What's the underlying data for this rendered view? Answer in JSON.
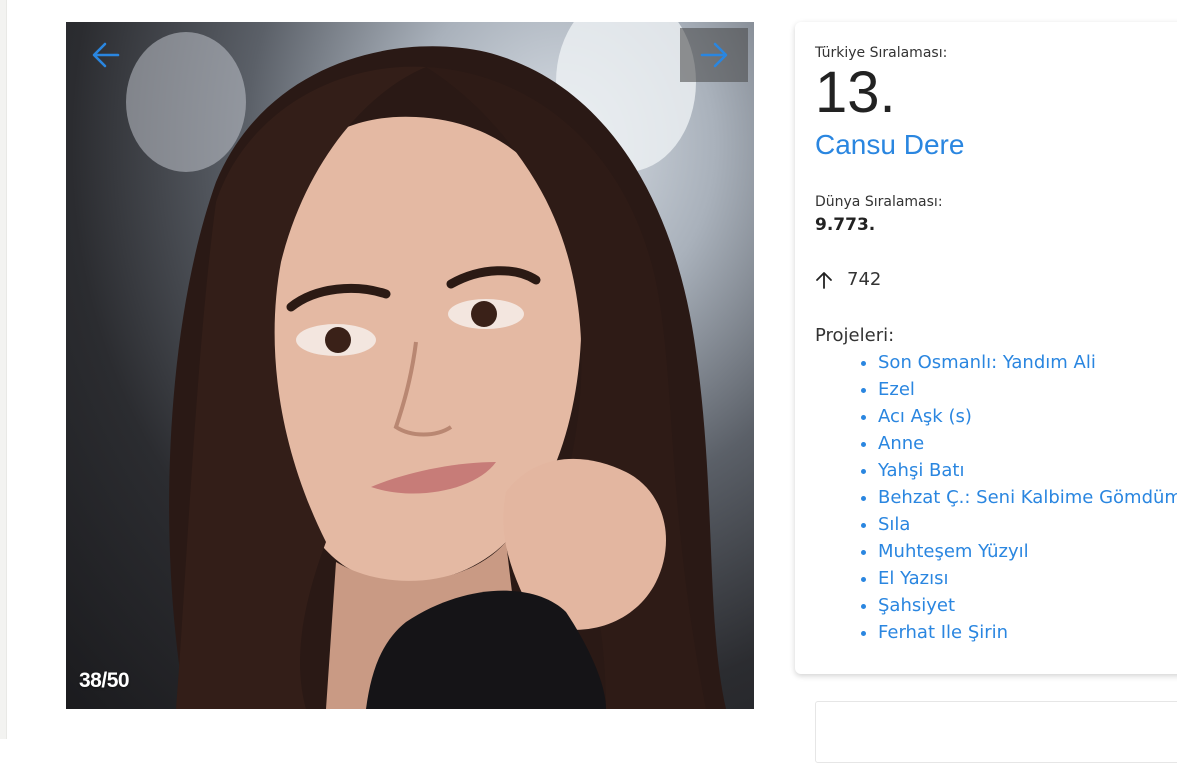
{
  "slider": {
    "counter": "38/50",
    "prev_icon": "arrow-left-icon",
    "next_icon": "arrow-right-icon",
    "accent": "#2a86e0"
  },
  "profile": {
    "turkey_rank_label": "Türkiye Sıralaması:",
    "turkey_rank": "13.",
    "name": "Cansu Dere",
    "world_rank_label": "Dünya Sıralaması:",
    "world_rank": "9.773.",
    "change_icon": "arrow-up-icon",
    "change_value": "742",
    "projects_label": "Projeleri:",
    "projects": [
      "Son Osmanlı: Yandım Ali",
      "Ezel",
      "Acı Aşk (s)",
      "Anne",
      "Yahşi Batı",
      "Behzat Ç.: Seni Kalbime Gömdüm",
      "Sıla",
      "Muhteşem Yüzyıl",
      "El Yazısı",
      "Şahsiyet",
      "Ferhat Ile Şirin"
    ]
  },
  "colors": {
    "link": "#2a86e0",
    "text": "#222222"
  }
}
